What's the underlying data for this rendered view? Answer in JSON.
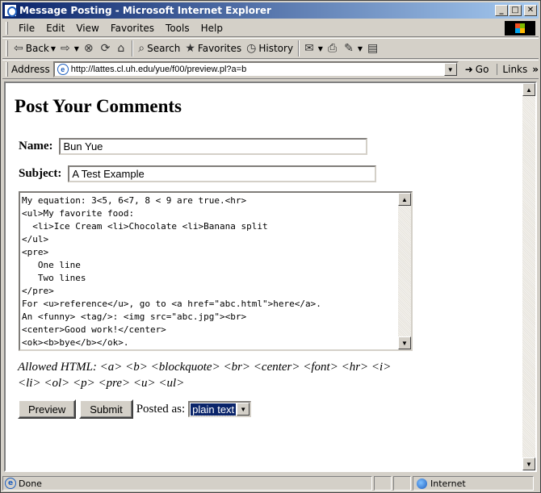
{
  "window": {
    "title": "Message Posting - Microsoft Internet Explorer",
    "minimize_glyph": "_",
    "maximize_glyph": "□",
    "close_glyph": "✕"
  },
  "menu": [
    "File",
    "Edit",
    "View",
    "Favorites",
    "Tools",
    "Help"
  ],
  "toolbar": {
    "back": "Back",
    "forward_glyph": "⇨",
    "search": "Search",
    "favorites": "Favorites",
    "history": "History"
  },
  "address": {
    "label": "Address",
    "url": "http://lattes.cl.uh.edu/yue/f00/preview.pl?a=b",
    "go": "Go",
    "links": "Links"
  },
  "page": {
    "heading": "Post Your Comments",
    "name_label": "Name:",
    "name_value": "Bun Yue",
    "subject_label": "Subject:",
    "subject_value": "A Test Example",
    "message": "My equation: 3<5, 6<7, 8 < 9 are true.<hr>\n<ul>My favorite food:\n  <li>Ice Cream <li>Chocolate <li>Banana split\n</ul>\n<pre>\n   One line\n   Two lines\n</pre>\nFor <u>reference</u>, go to <a href=\"abc.html\">here</a>.\nAn <funny> <tag/>: <img src=\"abc.jpg\"><br>\n<center>Good work!</center>\n<ok><b>bye</b></ok>.",
    "allowed_html": "Allowed HTML: <a> <b> <blockquote> <br> <center> <font> <hr> <i> <li> <ol> <p> <pre> <u> <ul>",
    "preview_button": "Preview",
    "submit_button": "Submit",
    "posted_as_label": "Posted as:",
    "posted_as_value": "plain text"
  },
  "status": {
    "text": "Done",
    "zone": "Internet"
  },
  "colors": {
    "title_gradient_start": "#0a246a",
    "title_gradient_end": "#a6caf0",
    "chrome": "#d4d0c8",
    "selection": "#0a246a"
  }
}
